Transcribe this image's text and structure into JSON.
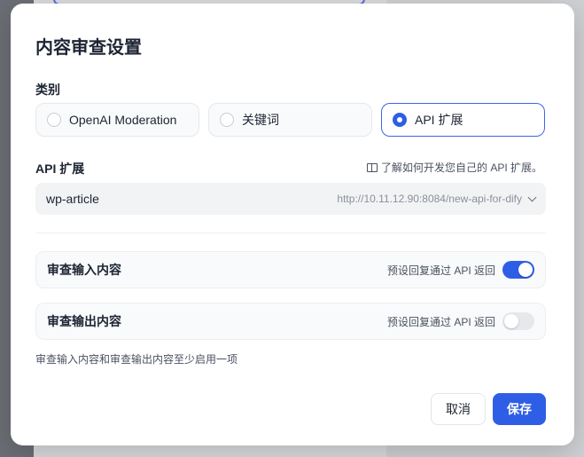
{
  "dialog": {
    "title": "内容审查设置",
    "category_label": "类别",
    "categories": [
      {
        "label": "OpenAI Moderation",
        "selected": false
      },
      {
        "label": "关键词",
        "selected": false
      },
      {
        "label": "API 扩展",
        "selected": true
      }
    ],
    "api_label": "API 扩展",
    "doc_link": "了解如何开发您自己的 API 扩展。",
    "api_select": {
      "value": "wp-article",
      "url": "http://10.11.12.90:8084/new-api-for-dify"
    },
    "toggles": [
      {
        "label": "审查输入内容",
        "hint": "预设回复通过 API 返回",
        "on": true
      },
      {
        "label": "审查输出内容",
        "hint": "预设回复通过 API 返回",
        "on": false
      }
    ],
    "footnote": "审查输入内容和审查输出内容至少启用一项",
    "cancel_label": "取消",
    "save_label": "保存"
  },
  "colors": {
    "accent": "#2f5ee6",
    "text": "#1d2433",
    "muted": "#4a5261"
  }
}
